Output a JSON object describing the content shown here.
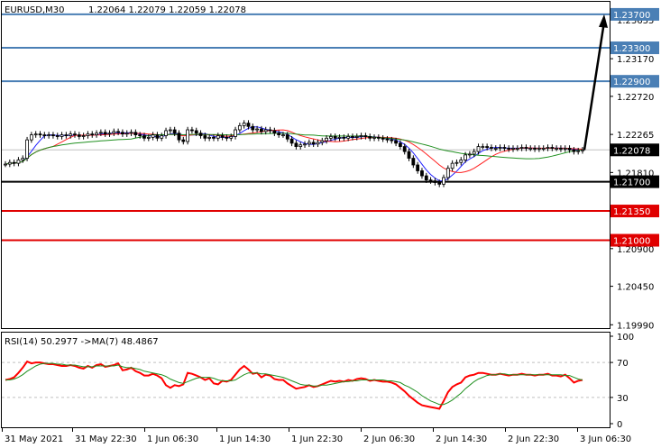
{
  "chart_data": [
    {
      "type": "candlestick",
      "title": "EURUSD,M30",
      "symbol": "EURUSD",
      "timeframe": "M30",
      "ohlc_header": "1.22064 1.22079 1.22059 1.22078",
      "y_ticks": [
        "1.23635",
        "1.23170",
        "1.22720",
        "1.22265",
        "1.21810",
        "1.20900",
        "1.20450",
        "1.19990"
      ],
      "ylim": [
        1.1995,
        1.2385
      ],
      "current_price": "1.22078",
      "levels": [
        {
          "value": 1.237,
          "label": "1.23700",
          "color": "#4a7fb5"
        },
        {
          "value": 1.233,
          "label": "1.23300",
          "color": "#4a7fb5"
        },
        {
          "value": 1.229,
          "label": "1.22900",
          "color": "#4a7fb5"
        },
        {
          "value": 1.217,
          "label": "1.21700",
          "color": "#000000"
        },
        {
          "value": 1.2135,
          "label": "1.21350",
          "color": "#e00000"
        },
        {
          "value": 1.21,
          "label": "1.21000",
          "color": "#e00000"
        }
      ],
      "close": [
        1.2191,
        1.2193,
        1.2192,
        1.2196,
        1.2198,
        1.222,
        1.2226,
        1.2227,
        1.2226,
        1.2225,
        1.2226,
        1.2225,
        1.2224,
        1.2226,
        1.2225,
        1.2227,
        1.2226,
        1.2224,
        1.2225,
        1.2227,
        1.2226,
        1.2228,
        1.2229,
        1.2227,
        1.2228,
        1.223,
        1.2229,
        1.2227,
        1.2228,
        1.2229,
        1.2226,
        1.2225,
        1.2222,
        1.2223,
        1.2226,
        1.2222,
        1.2225,
        1.2231,
        1.2232,
        1.2228,
        1.222,
        1.2218,
        1.2232,
        1.2231,
        1.2228,
        1.2225,
        1.2222,
        1.2223,
        1.2222,
        1.2225,
        1.2223,
        1.2222,
        1.2224,
        1.2232,
        1.2237,
        1.224,
        1.2236,
        1.2232,
        1.2233,
        1.223,
        1.2232,
        1.2231,
        1.2228,
        1.2226,
        1.2226,
        1.2221,
        1.2216,
        1.2212,
        1.2214,
        1.2215,
        1.2217,
        1.2215,
        1.2217,
        1.2219,
        1.2222,
        1.2224,
        1.2222,
        1.2223,
        1.2222,
        1.2224,
        1.2223,
        1.2224,
        1.2225,
        1.2224,
        1.2222,
        1.2223,
        1.2222,
        1.2221,
        1.222,
        1.2219,
        1.2216,
        1.2212,
        1.2206,
        1.2198,
        1.219,
        1.2183,
        1.2177,
        1.2172,
        1.2171,
        1.2169,
        1.2167,
        1.2175,
        1.2186,
        1.2192,
        1.2193,
        1.2196,
        1.2202,
        1.2203,
        1.2206,
        1.2212,
        1.2212,
        1.2211,
        1.221,
        1.221,
        1.2211,
        1.221,
        1.2209,
        1.221,
        1.221,
        1.2211,
        1.221,
        1.221,
        1.2209,
        1.221,
        1.221,
        1.2211,
        1.221,
        1.221,
        1.2209,
        1.221,
        1.2208,
        1.2206,
        1.2207,
        1.2208
      ],
      "ma_series": [
        {
          "color": "#2020ff"
        },
        {
          "color": "#ff2020"
        },
        {
          "color": "#209020"
        }
      ],
      "projection": {
        "from": 1.22078,
        "to": 1.237
      }
    },
    {
      "type": "line",
      "title": "RSI(14) 50.2977  ->MA(7) 48.4867",
      "y_ticks": [
        "100",
        "70",
        "30",
        "0"
      ],
      "ylim": [
        0,
        100
      ],
      "levels": [
        70,
        30
      ],
      "series": [
        {
          "color": "#ff0000",
          "values": [
            50,
            51,
            53,
            58,
            64,
            71,
            69,
            70,
            70,
            69,
            68,
            68,
            67,
            66,
            66,
            67,
            66,
            64,
            63,
            66,
            64,
            67,
            68,
            65,
            66,
            67,
            69,
            61,
            62,
            64,
            60,
            58,
            55,
            55,
            57,
            55,
            52,
            44,
            41,
            44,
            43,
            45,
            58,
            57,
            55,
            53,
            50,
            52,
            46,
            45,
            49,
            48,
            50,
            56,
            62,
            66,
            62,
            57,
            58,
            53,
            56,
            55,
            51,
            50,
            50,
            46,
            43,
            40,
            41,
            42,
            44,
            42,
            43,
            45,
            47,
            49,
            48,
            49,
            48,
            50,
            49,
            51,
            52,
            51,
            49,
            50,
            49,
            48,
            48,
            47,
            45,
            41,
            37,
            32,
            28,
            24,
            21,
            20,
            19,
            18,
            17,
            26,
            36,
            42,
            45,
            47,
            53,
            55,
            56,
            58,
            58,
            57,
            56,
            56,
            57,
            56,
            55,
            56,
            56,
            57,
            56,
            56,
            55,
            56,
            56,
            57,
            55,
            55,
            54,
            56,
            52,
            47,
            49,
            50
          ]
        },
        {
          "color": "#209020",
          "values": [
            50,
            50,
            51,
            53,
            56,
            60,
            63,
            66,
            68,
            69,
            69,
            69,
            68,
            68,
            67,
            67,
            67,
            66,
            65,
            65,
            65,
            66,
            66,
            66,
            66,
            66,
            67,
            65,
            64,
            64,
            63,
            62,
            60,
            59,
            58,
            57,
            56,
            54,
            51,
            49,
            47,
            46,
            48,
            50,
            52,
            53,
            53,
            53,
            52,
            50,
            49,
            49,
            49,
            50,
            53,
            56,
            58,
            58,
            58,
            57,
            57,
            56,
            55,
            54,
            53,
            51,
            49,
            47,
            45,
            44,
            44,
            43,
            43,
            44,
            44,
            45,
            46,
            47,
            48,
            48,
            49,
            49,
            50,
            50,
            50,
            50,
            50,
            50,
            49,
            49,
            48,
            47,
            44,
            42,
            39,
            36,
            32,
            29,
            26,
            24,
            22,
            22,
            24,
            27,
            31,
            35,
            40,
            44,
            48,
            51,
            53,
            55,
            56,
            56,
            57,
            57,
            56,
            56,
            56,
            56,
            56,
            56,
            56,
            56,
            56,
            56,
            56,
            56,
            56,
            55,
            55,
            53,
            51,
            50
          ]
        }
      ]
    }
  ],
  "x_ticks": [
    "31 May 2021",
    "31 May 22:30",
    "1 Jun 06:30",
    "1 Jun 14:30",
    "1 Jun 22:30",
    "2 Jun 06:30",
    "2 Jun 14:30",
    "2 Jun 22:30",
    "3 Jun 06:30"
  ]
}
